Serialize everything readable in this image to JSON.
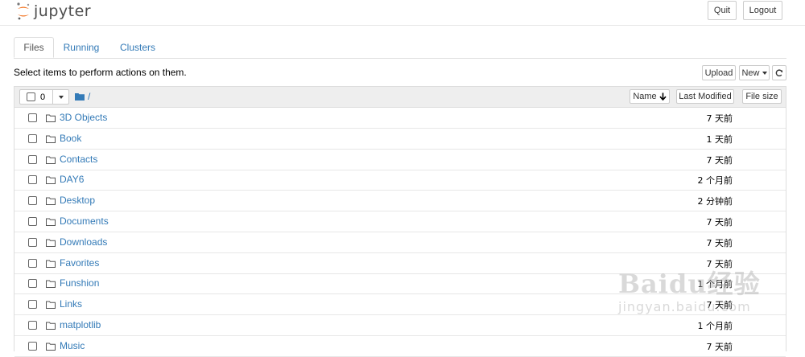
{
  "header": {
    "logo_text": "jupyter",
    "quit_label": "Quit",
    "logout_label": "Logout"
  },
  "tabs": [
    {
      "label": "Files"
    },
    {
      "label": "Running"
    },
    {
      "label": "Clusters"
    }
  ],
  "toolbar": {
    "hint": "Select items to perform actions on them.",
    "upload_label": "Upload",
    "new_label": "New",
    "refresh_icon": "refresh-icon"
  },
  "list_header": {
    "selected_count": "0",
    "breadcrumb": "/",
    "name_label": "Name",
    "last_modified_label": "Last Modified",
    "file_size_label": "File size"
  },
  "files": [
    {
      "name": "3D Objects",
      "modified": "7 天前"
    },
    {
      "name": "Book",
      "modified": "1 天前"
    },
    {
      "name": "Contacts",
      "modified": "7 天前"
    },
    {
      "name": "DAY6",
      "modified": "2 个月前"
    },
    {
      "name": "Desktop",
      "modified": "2 分钟前"
    },
    {
      "name": "Documents",
      "modified": "7 天前"
    },
    {
      "name": "Downloads",
      "modified": "7 天前"
    },
    {
      "name": "Favorites",
      "modified": "7 天前"
    },
    {
      "name": "Funshion",
      "modified": "1 个月前"
    },
    {
      "name": "Links",
      "modified": "7 天前"
    },
    {
      "name": "matplotlib",
      "modified": "1 个月前"
    },
    {
      "name": "Music",
      "modified": "7 天前"
    }
  ],
  "watermark": {
    "logo": "Baidu经验",
    "sub": "jingyan.baidu.com"
  },
  "colors": {
    "link": "#337ab7",
    "jupyter_orange": "#f37726"
  }
}
